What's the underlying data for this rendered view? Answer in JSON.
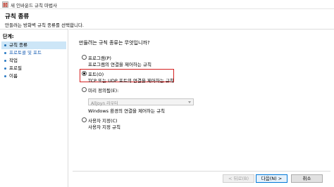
{
  "window": {
    "title": "새 인바운드 규칙 마법사",
    "icon": "firewall-app-icon"
  },
  "header": {
    "title": "규칙 종류",
    "description": "만들려는 방화벽 규칙 종류를 선택합니다."
  },
  "sidebar": {
    "heading": "단계:",
    "steps": [
      {
        "label": "규칙 종류",
        "state": "current"
      },
      {
        "label": "프로토콜 및 포트",
        "state": "link"
      },
      {
        "label": "작업",
        "state": "plain"
      },
      {
        "label": "프로필",
        "state": "plain"
      },
      {
        "label": "이름",
        "state": "plain"
      }
    ]
  },
  "main": {
    "question": "만들려는 규칙 종류는 무엇입니까?",
    "options": [
      {
        "label": "프로그램(P)",
        "description": "프로그램의 연결을 제어하는 규칙",
        "selected": false
      },
      {
        "label": "포트(O)",
        "description": "TCP 또는 UDP 포트의 연결을 제어하는 규칙",
        "selected": true
      },
      {
        "label": "미리 정의됨(E):",
        "description": "Windows 환경의 연결을 제어하는 규칙",
        "selected": false
      },
      {
        "label": "사용자 지정(C)",
        "description": "사용자 지정 규칙",
        "selected": false
      }
    ],
    "predefined_dropdown_value": "AllJoyn 라우터"
  },
  "buttons": {
    "back": "< 뒤로(B)",
    "next": "다음(N) >",
    "cancel": "취소"
  },
  "colors": {
    "highlight": "#d42020",
    "selected_step_bg": "#cde6f7",
    "link": "#1a5fb4"
  }
}
